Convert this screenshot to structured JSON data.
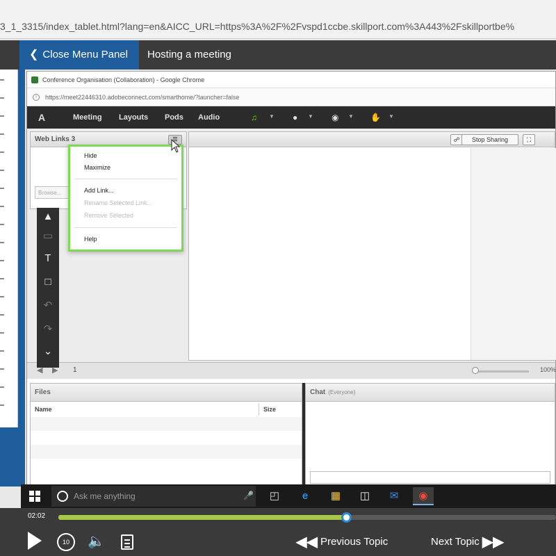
{
  "outer_browser": {
    "url": "3_1_3315/index_tablet.html?lang=en&AICC_URL=https%3A%2F%2Fvspd1ccbe.skillport.com%3A443%2Fskillportbe%"
  },
  "course_header": {
    "close_menu_label": "Close Menu Panel",
    "title": "Hosting a meeting"
  },
  "inner_window": {
    "title": "Conference Organisation (Collaboration) - Google Chrome",
    "url": "https://meet22446310.adobeconnect.com/smarthome/?launcher=false"
  },
  "ac_toolbar": {
    "logo": "A",
    "menus": [
      "Meeting",
      "Layouts",
      "Pods",
      "Audio"
    ]
  },
  "weblinks_pod": {
    "title": "Web Links 3",
    "browse_label": "Browse..."
  },
  "share_pod": {
    "stop_sharing_label": "Stop Sharing"
  },
  "context_menu": {
    "items": [
      {
        "label": "Hide",
        "enabled": true
      },
      {
        "label": "Maximize",
        "enabled": true
      },
      {
        "label": "Add Link...",
        "enabled": true
      },
      {
        "label": "Rename Selected Link...",
        "enabled": false
      },
      {
        "label": "Remove Selected",
        "enabled": false
      },
      {
        "label": "Help",
        "enabled": true
      }
    ]
  },
  "stage_bottom": {
    "page_number": "1",
    "zoom": "100%"
  },
  "files_pod": {
    "title": "Files",
    "columns": [
      "Name",
      "Size"
    ]
  },
  "chat_pod": {
    "title": "Chat",
    "audience": "(Everyone)"
  },
  "taskbar": {
    "search_placeholder": "Ask me anything"
  },
  "player": {
    "time": "02:02",
    "progress_percent": 58,
    "previous_label": "Previous Topic",
    "next_label": "Next Topic"
  },
  "colors": {
    "accent_blue": "#1f5d9c",
    "progress_green": "#a8c84a",
    "context_menu_border": "#7ed957"
  }
}
